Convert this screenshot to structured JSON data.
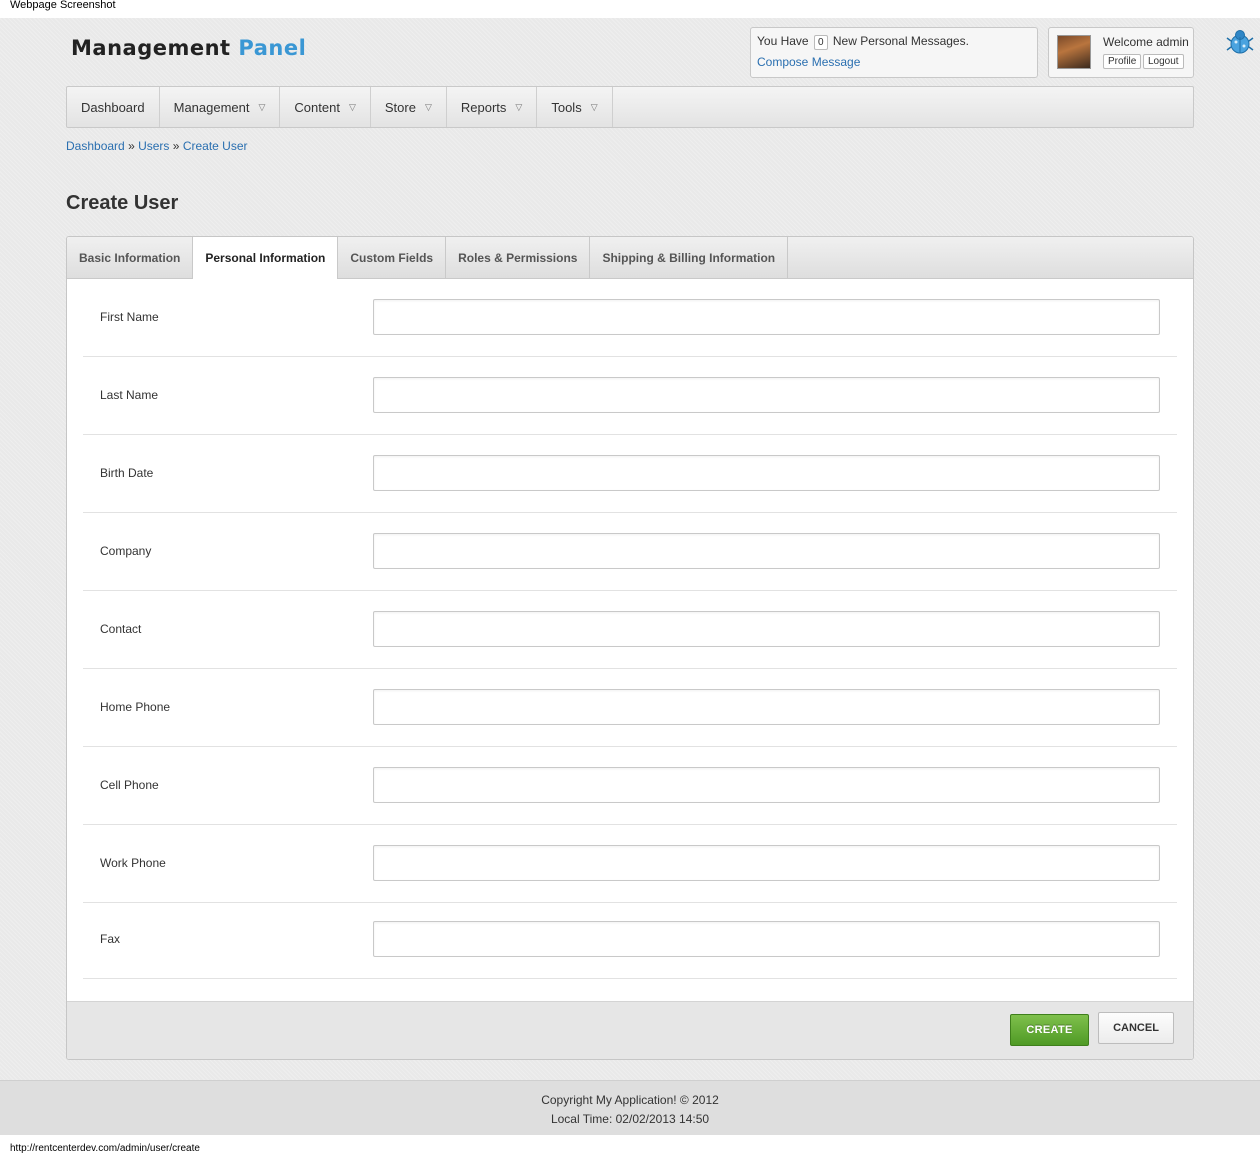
{
  "window": {
    "caption": "Webpage Screenshot",
    "status_url": "http://rentcenterdev.com/admin/user/create"
  },
  "header": {
    "logo_main": "Management",
    "logo_accent": "Panel",
    "messages": {
      "prefix": "You Have",
      "count": "0",
      "suffix": "New Personal Messages.",
      "compose_label": "Compose Message"
    },
    "user": {
      "welcome": "Welcome admin",
      "profile_label": "Profile",
      "logout_label": "Logout"
    },
    "bug_icon": "bug-icon"
  },
  "nav": {
    "items": [
      {
        "label": "Dashboard",
        "has_dropdown": false
      },
      {
        "label": "Management",
        "has_dropdown": true
      },
      {
        "label": "Content",
        "has_dropdown": true
      },
      {
        "label": "Store",
        "has_dropdown": true
      },
      {
        "label": "Reports",
        "has_dropdown": true
      },
      {
        "label": "Tools",
        "has_dropdown": true
      }
    ]
  },
  "breadcrumb": {
    "items": [
      "Dashboard",
      "Users",
      "Create User"
    ],
    "separator": "»"
  },
  "page": {
    "title": "Create User"
  },
  "form": {
    "tabs": [
      {
        "label": "Basic Information",
        "active": false
      },
      {
        "label": "Personal Information",
        "active": true
      },
      {
        "label": "Custom Fields",
        "active": false
      },
      {
        "label": "Roles & Permissions",
        "active": false
      },
      {
        "label": "Shipping & Billing Information",
        "active": false
      }
    ],
    "fields": [
      {
        "label": "First Name",
        "value": ""
      },
      {
        "label": "Last Name",
        "value": ""
      },
      {
        "label": "Birth Date",
        "value": ""
      },
      {
        "label": "Company",
        "value": ""
      },
      {
        "label": "Contact",
        "value": ""
      },
      {
        "label": "Home Phone",
        "value": ""
      },
      {
        "label": "Cell Phone",
        "value": ""
      },
      {
        "label": "Work Phone",
        "value": ""
      },
      {
        "label": "Fax",
        "value": ""
      }
    ],
    "create_label": "CREATE",
    "cancel_label": "CANCEL",
    "create_color": "#5aa62c"
  },
  "footer": {
    "copyright": "Copyright My Application! © 2012",
    "local_time": "Local Time: 02/02/2013 14:50"
  }
}
